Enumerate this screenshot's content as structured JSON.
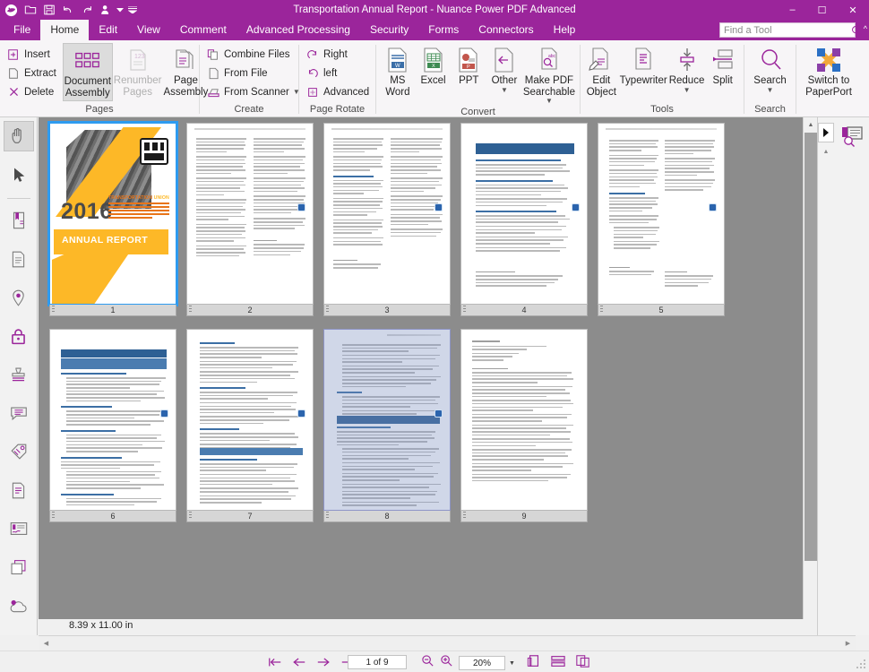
{
  "window": {
    "title": "Transportation Annual Report - Nuance Power PDF Advanced",
    "minimize_label": "–",
    "maximize_label": "☐",
    "close_label": "✕"
  },
  "quick_access": [
    {
      "name": "app-logo-icon",
      "label": "Nuance"
    },
    {
      "name": "open-icon",
      "label": "Open"
    },
    {
      "name": "save-icon",
      "label": "Save"
    },
    {
      "name": "undo-icon",
      "label": "Undo"
    },
    {
      "name": "redo-icon",
      "label": "Redo"
    },
    {
      "name": "user-icon",
      "label": "User"
    },
    {
      "name": "customize-qat-icon",
      "label": "Customize Quick Access Toolbar"
    }
  ],
  "menu": {
    "items": [
      {
        "label": "File",
        "active": false
      },
      {
        "label": "Home",
        "active": true
      },
      {
        "label": "Edit",
        "active": false
      },
      {
        "label": "View",
        "active": false
      },
      {
        "label": "Comment",
        "active": false
      },
      {
        "label": "Advanced Processing",
        "active": false
      },
      {
        "label": "Security",
        "active": false
      },
      {
        "label": "Forms",
        "active": false
      },
      {
        "label": "Connectors",
        "active": false
      },
      {
        "label": "Help",
        "active": false
      }
    ]
  },
  "find_tool": {
    "placeholder": "Find a Tool",
    "value": "",
    "icon": "search-icon",
    "collapse_icon": "chevron-up-icon"
  },
  "ribbon": {
    "groups": [
      {
        "title": "Pages",
        "small_commands": [
          {
            "label": "Insert",
            "icon": "insert-page-icon"
          },
          {
            "label": "Extract",
            "icon": "extract-page-icon"
          },
          {
            "label": "Delete",
            "icon": "delete-page-icon"
          }
        ],
        "large_commands": [
          {
            "line1": "Document",
            "line2": "Assembly",
            "icon": "document-assembly-icon",
            "selected": true,
            "disabled": false
          },
          {
            "line1": "Renumber",
            "line2": "Pages",
            "icon": "renumber-pages-icon",
            "selected": false,
            "disabled": true
          },
          {
            "line1": "Page",
            "line2": "Assembly",
            "icon": "page-assembly-icon",
            "selected": false,
            "disabled": false
          }
        ]
      },
      {
        "title": "Create",
        "small_commands": [
          {
            "label": "Combine Files",
            "icon": "combine-files-icon"
          },
          {
            "label": "From File",
            "icon": "from-file-icon"
          },
          {
            "label": "From Scanner",
            "icon": "from-scanner-icon",
            "dropdown": true
          }
        ],
        "large_commands": []
      },
      {
        "title": "Page Rotate",
        "small_commands": [
          {
            "label": "Right",
            "icon": "rotate-right-icon"
          },
          {
            "label": "left",
            "icon": "rotate-left-icon"
          },
          {
            "label": "Advanced",
            "icon": "rotate-advanced-icon"
          }
        ],
        "large_commands": []
      },
      {
        "title": "Convert",
        "small_commands": [],
        "large_commands": [
          {
            "line1": "MS",
            "line2": "Word",
            "icon": "ms-word-icon",
            "selected": false,
            "disabled": false
          },
          {
            "line1": "Excel",
            "line2": "",
            "icon": "excel-icon",
            "selected": false,
            "disabled": false
          },
          {
            "line1": "PPT",
            "line2": "",
            "icon": "powerpoint-icon",
            "selected": false,
            "disabled": false
          },
          {
            "line1": "Other",
            "line2": "",
            "icon": "other-convert-icon",
            "selected": false,
            "disabled": false,
            "dropdown": true
          },
          {
            "line1": "Make PDF",
            "line2": "Searchable",
            "icon": "make-pdf-searchable-icon",
            "selected": false,
            "disabled": false,
            "dropdown_inline": true
          }
        ]
      },
      {
        "title": "Tools",
        "small_commands": [],
        "large_commands": [
          {
            "line1": "Edit",
            "line2": "Object",
            "icon": "edit-object-icon",
            "selected": false,
            "disabled": false
          },
          {
            "line1": "Typewriter",
            "line2": "",
            "icon": "typewriter-icon",
            "selected": false,
            "disabled": false
          },
          {
            "line1": "Reduce",
            "line2": "",
            "icon": "reduce-icon",
            "selected": false,
            "disabled": false,
            "dropdown": true
          },
          {
            "line1": "Split",
            "line2": "",
            "icon": "split-icon",
            "selected": false,
            "disabled": false
          }
        ]
      },
      {
        "title": "Search",
        "small_commands": [],
        "large_commands": [
          {
            "line1": "Search",
            "line2": "",
            "icon": "search-icon",
            "selected": false,
            "disabled": false,
            "dropdown": true
          }
        ]
      },
      {
        "title": "",
        "small_commands": [],
        "large_commands": [
          {
            "line1": "Switch to",
            "line2": "PaperPort",
            "icon": "paperport-icon",
            "selected": false,
            "disabled": false
          }
        ]
      }
    ]
  },
  "tool_rail": [
    {
      "name": "hand-tool-icon",
      "label": "Hand Tool",
      "active": true
    },
    {
      "name": "select-tool-icon",
      "label": "Select Tool",
      "active": false
    },
    {
      "name": "bookmarks-icon",
      "label": "Bookmarks",
      "active": false
    },
    {
      "name": "pages-panel-icon",
      "label": "Pages",
      "active": false
    },
    {
      "name": "destinations-icon",
      "label": "Destinations",
      "active": false
    },
    {
      "name": "security-lock-icon",
      "label": "Security",
      "active": false
    },
    {
      "name": "stamps-icon",
      "label": "Stamps",
      "active": false
    },
    {
      "name": "comments-icon",
      "label": "Comments",
      "active": false
    },
    {
      "name": "attachments-icon",
      "label": "Attachments",
      "active": false
    },
    {
      "name": "model-tree-icon",
      "label": "Content",
      "active": false
    },
    {
      "name": "signatures-icon",
      "label": "Signatures",
      "active": false
    },
    {
      "name": "layers-icon",
      "label": "Layers",
      "active": false
    },
    {
      "name": "cloud-connector-icon",
      "label": "Cloud Connectors",
      "active": false
    }
  ],
  "right_panel": {
    "expand_icon": "chevron-right-icon",
    "scroll_up_icon": "chevron-up-icon",
    "panel_icon": "bookmark-search-icon"
  },
  "document": {
    "pages": [
      {
        "number": "1",
        "type": "cover",
        "selected": true,
        "active_selection": false
      },
      {
        "number": "2",
        "type": "two-column",
        "selected": false,
        "active_selection": false
      },
      {
        "number": "3",
        "type": "two-column",
        "selected": false,
        "active_selection": false
      },
      {
        "number": "4",
        "type": "blue-header",
        "selected": false,
        "active_selection": false
      },
      {
        "number": "5",
        "type": "two-column",
        "selected": false,
        "active_selection": false
      },
      {
        "number": "6",
        "type": "annex",
        "selected": false,
        "active_selection": false
      },
      {
        "number": "7",
        "type": "mixed-band",
        "selected": false,
        "active_selection": false
      },
      {
        "number": "8",
        "type": "mixed-band",
        "selected": false,
        "active_selection": true
      },
      {
        "number": "9",
        "type": "list-page",
        "selected": false,
        "active_selection": false
      }
    ],
    "cover": {
      "year": "2016",
      "report_title": "ANNUAL REPORT",
      "org_prefix": "TRANSPORTATION",
      "org_suffix": "UNION"
    },
    "page4_heading": "2/4. Ten goals for a competitive and resource-efficient transport system: benchmarks for achieving the 60% GHG emission reduction target",
    "page6_heading": "Annex: List of Initiatives",
    "page6_subheading": "1. AN EFFICIENT AND INTEGRATED MOBILITY SYSTEM",
    "page8_heading": "3. THE EXTERNAL DIMENSION"
  },
  "status": {
    "page_dimensions": "8.39 x 11.00 in",
    "page_indicator": "1 of 9",
    "zoom_level": "20%",
    "nav": [
      {
        "name": "first-page-button",
        "glyph": "⇤"
      },
      {
        "name": "previous-page-button",
        "glyph": "←"
      },
      {
        "name": "next-page-button",
        "glyph": "→"
      },
      {
        "name": "last-page-button",
        "glyph": "⇥"
      }
    ],
    "zoom_out_icon": "zoom-out-icon",
    "zoom_in_icon": "zoom-in-icon",
    "view_modes": [
      {
        "name": "single-page-view-icon"
      },
      {
        "name": "fit-width-view-icon"
      },
      {
        "name": "facing-pages-view-icon"
      }
    ]
  }
}
